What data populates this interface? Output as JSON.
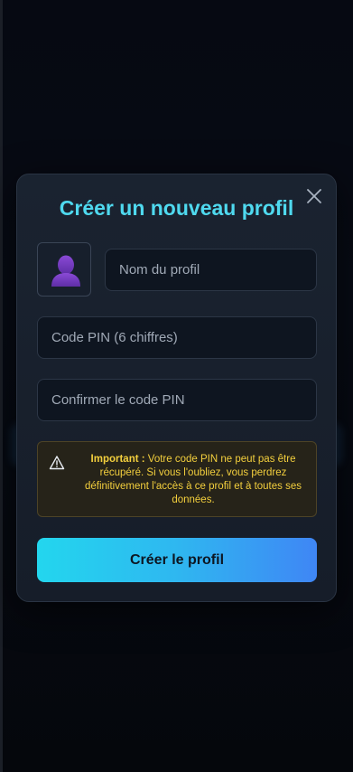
{
  "modal": {
    "title": "Créer un nouveau profil",
    "close_icon": "close-icon",
    "avatar_icon": "user-silhouette-icon",
    "name_placeholder": "Nom du profil",
    "pin_placeholder": "Code PIN (6 chiffres)",
    "confirm_pin_placeholder": "Confirmer le code PIN",
    "warning": {
      "icon": "warning-triangle-icon",
      "label": "Important :",
      "text": "Votre code PIN ne peut pas être récupéré. Si vous l'oubliez, vous perdrez définitivement l'accès à ce profil et à toutes ses données."
    },
    "submit_label": "Créer le profil"
  },
  "colors": {
    "accent_title": "#4fd9ef",
    "button_gradient_start": "#23d6ee",
    "button_gradient_end": "#3f86f5",
    "warning_text": "#f3cf3d",
    "avatar_purple": "#7b3fc4"
  }
}
